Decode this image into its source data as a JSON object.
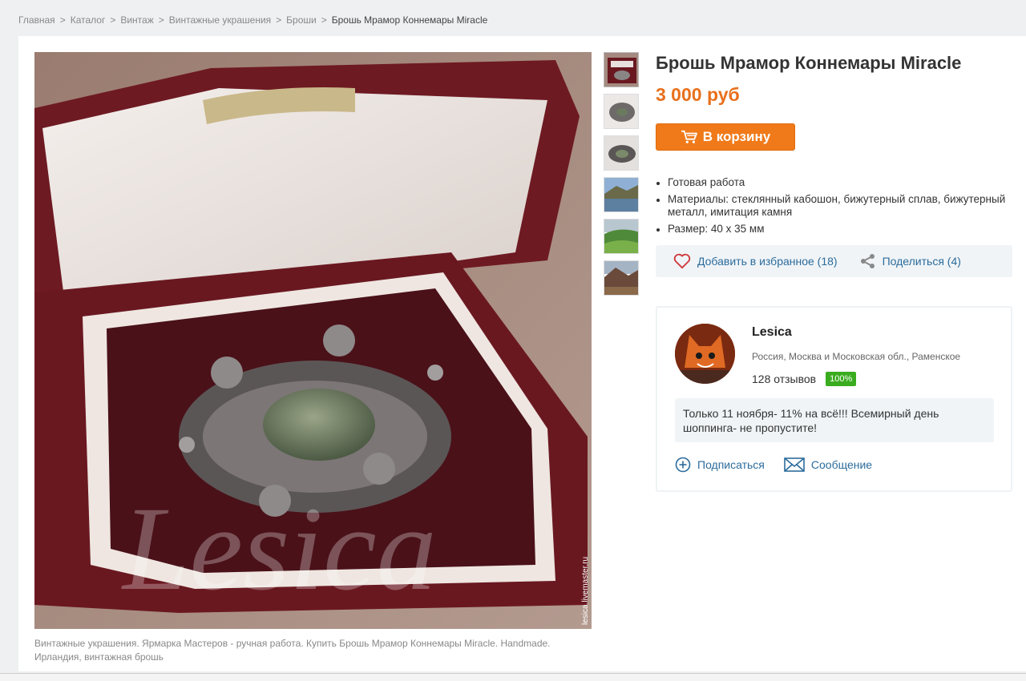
{
  "breadcrumb": {
    "items": [
      "Главная",
      "Каталог",
      "Винтаж",
      "Винтажные украшения",
      "Броши"
    ],
    "current": "Брошь Мрамор Коннемары Miracle",
    "separator": ">"
  },
  "product": {
    "title": "Брошь Мрамор Коннемары Miracle",
    "price": "3 000 руб",
    "cart_label": "В корзину",
    "photo_watermark": "Lesica",
    "photo_side_text": "lesica.livemaster.ru",
    "caption": "Винтажные украшения. Ярмарка Мастеров - ручная работа. Купить Брошь Мрамор Коннемары Miracle. Handmade. Ирландия, винтажная брошь",
    "properties": [
      "Готовая работа",
      "Материалы:  стеклянный кабошон, бижутерный сплав, бижутерный металл, имитация камня",
      "Размер: 40 х 35 мм"
    ],
    "favorite_label": "Добавить в избранное (18)",
    "share_label": "Поделиться (4)",
    "thumbnails": [
      "brooch-in-box",
      "brooch-closeup",
      "brooch-back",
      "lake-landscape",
      "green-hills",
      "mountain-landscape"
    ]
  },
  "seller": {
    "name": "Lesica",
    "location": "Россия, Москва и Московская обл., Раменское",
    "reviews": "128 отзывов",
    "rating": "100%",
    "promo": "Только 11 ноября- 11% на всё!!! Всемирный день шоппинга- не пропустите!",
    "subscribe_label": "Подписаться",
    "message_label": "Сообщение"
  },
  "colors": {
    "accent": "#f07a1a",
    "price": "#e8701c",
    "link": "#2c6c9c",
    "badge": "#3aac1f"
  }
}
